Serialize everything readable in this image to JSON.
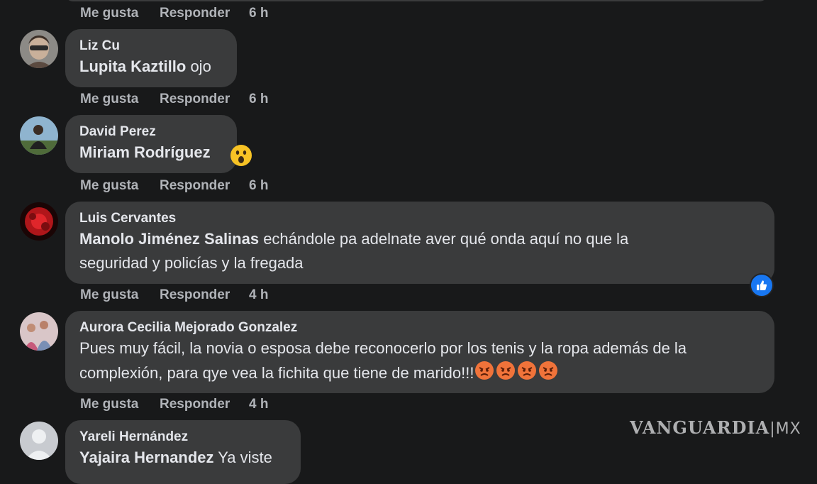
{
  "actions_labels": {
    "like": "Me gusta",
    "reply": "Responder"
  },
  "top_actions": {
    "time": "6 h"
  },
  "comments": [
    {
      "author": "Liz Cu",
      "mention": "Lupita Kaztillo",
      "text": " ojo",
      "time": "6 h"
    },
    {
      "author": "David Perez",
      "mention": "Miriam Rodríguez",
      "text": "",
      "time": "6 h"
    },
    {
      "author": "Luis Cervantes",
      "mention": "Manolo Jiménez Salinas",
      "text_line1": " echándole pa adelnate aver qué onda aquí no que la",
      "text_line2": "seguridad y policías y la fregada",
      "time": "4 h"
    },
    {
      "author": "Aurora Cecilia Mejorado Gonzalez",
      "text_line1": "Pues muy fácil, la novia o esposa debe reconocerlo por los tenis y la ropa además de la",
      "text_line2": "complexión, para qye vea la fichita que tiene de marido!!!",
      "time": "4 h"
    },
    {
      "author": "Yareli Hernández",
      "mention": "Yajaira Hernandez",
      "text": " Ya viste"
    }
  ],
  "watermark": {
    "brand": "VANGUARDIA",
    "suffix": "|MX"
  },
  "colors": {
    "background": "#18191a",
    "bubble": "#3a3b3c",
    "secondary_text": "#b0b3b8",
    "like_blue": "#1877f2",
    "angry": "#f0733a"
  }
}
